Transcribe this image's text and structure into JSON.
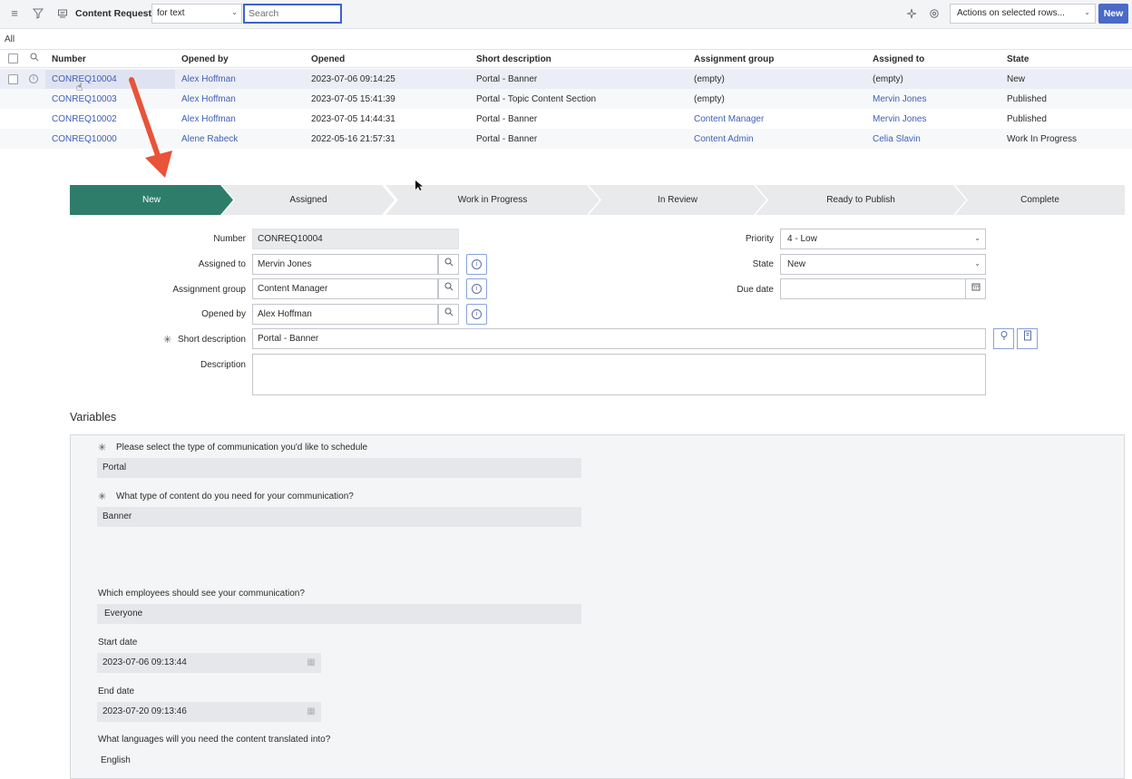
{
  "toolbar": {
    "title": "Content Requests",
    "filter_select": "for text",
    "search_placeholder": "Search",
    "actions_select": "Actions on selected rows...",
    "new_label": "New"
  },
  "list_scope": "All",
  "table": {
    "columns": [
      "Number",
      "Opened by",
      "Opened",
      "Short description",
      "Assignment group",
      "Assigned to",
      "State"
    ],
    "rows": [
      {
        "number": "CONREQ10004",
        "opened_by": "Alex Hoffman",
        "opened": "2023-07-06 09:14:25",
        "short_description": "Portal - Banner",
        "assignment_group": "(empty)",
        "assigned_to": "(empty)",
        "state": "New"
      },
      {
        "number": "CONREQ10003",
        "opened_by": "Alex Hoffman",
        "opened": "2023-07-05 15:41:39",
        "short_description": "Portal - Topic Content Section",
        "assignment_group": "(empty)",
        "assigned_to": "Mervin Jones",
        "state": "Published"
      },
      {
        "number": "CONREQ10002",
        "opened_by": "Alex Hoffman",
        "opened": "2023-07-05 14:44:31",
        "short_description": "Portal - Banner",
        "assignment_group": "Content Manager",
        "assigned_to": "Mervin Jones",
        "state": "Published"
      },
      {
        "number": "CONREQ10000",
        "opened_by": "Alene Rabeck",
        "opened": "2022-05-16 21:57:31",
        "short_description": "Portal - Banner",
        "assignment_group": "Content Admin",
        "assigned_to": "Celia Slavin",
        "state": "Work In Progress"
      }
    ]
  },
  "flow": {
    "steps": [
      "New",
      "Assigned",
      "Work in Progress",
      "In Review",
      "Ready to Publish",
      "Complete"
    ],
    "active_index": 0,
    "active_color": "#2e7d6b"
  },
  "form": {
    "number_label": "Number",
    "number_value": "CONREQ10004",
    "assigned_to_label": "Assigned to",
    "assigned_to_value": "Mervin Jones",
    "assignment_group_label": "Assignment group",
    "assignment_group_value": "Content Manager",
    "opened_by_label": "Opened by",
    "opened_by_value": "Alex Hoffman",
    "short_description_label": "Short description",
    "short_description_value": "Portal - Banner",
    "description_label": "Description",
    "description_value": "",
    "priority_label": "Priority",
    "priority_value": "4 - Low",
    "state_label": "State",
    "state_value": "New",
    "due_date_label": "Due date",
    "due_date_value": ""
  },
  "variables": {
    "title": "Variables",
    "q1": "Please select the type of communication you'd like to schedule",
    "a1": "Portal",
    "q2": "What type of content do you need for your communication?",
    "a2": "Banner",
    "q3": "Which employees should see your communication?",
    "a3": "Everyone",
    "start_label": "Start date",
    "start_value": "2023-07-06 09:13:44",
    "end_label": "End date",
    "end_value": "2023-07-20 09:13:46",
    "q4": "What languages will you need the content translated into?",
    "a4": "English"
  },
  "colors": {
    "link": "#3f5fb5",
    "primary_button": "#4a6ac8",
    "annotation_arrow": "#e8533a"
  }
}
